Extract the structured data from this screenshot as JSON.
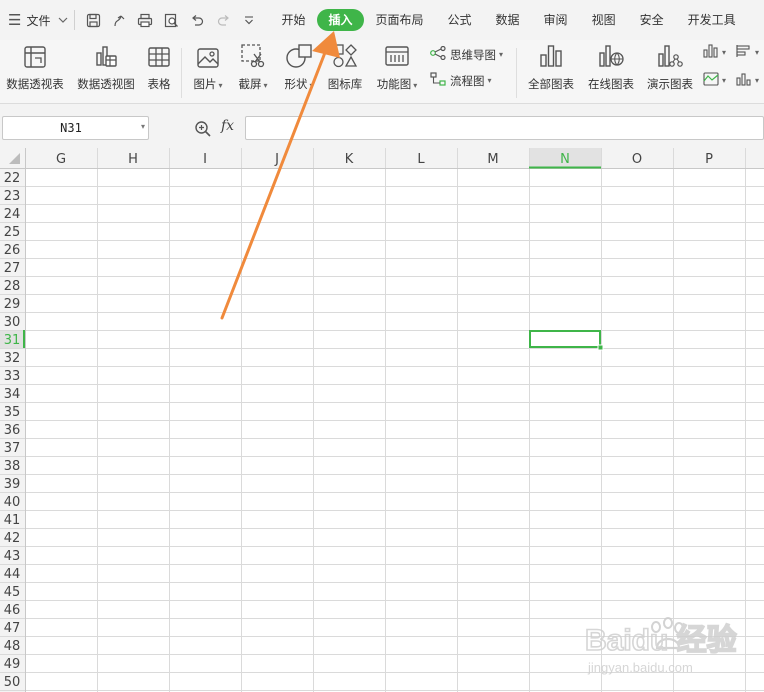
{
  "menubar": {
    "file_label": "文件",
    "tabs": [
      {
        "label": "开始",
        "active": false
      },
      {
        "label": "插入",
        "active": true
      },
      {
        "label": "页面布局",
        "active": false
      },
      {
        "label": "公式",
        "active": false
      },
      {
        "label": "数据",
        "active": false
      },
      {
        "label": "审阅",
        "active": false
      },
      {
        "label": "视图",
        "active": false
      },
      {
        "label": "安全",
        "active": false
      },
      {
        "label": "开发工具",
        "active": false
      }
    ]
  },
  "ribbon": {
    "pivot_table": "数据透视表",
    "pivot_chart": "数据透视图",
    "table": "表格",
    "picture": "图片",
    "screenshot": "截屏",
    "shapes": "形状",
    "icon_library": "图标库",
    "function_chart": "功能图",
    "mind_map": "思维导图",
    "flowchart": "流程图",
    "all_charts": "全部图表",
    "online_charts": "在线图表",
    "demo_charts": "演示图表"
  },
  "formula_bar": {
    "cell_ref": "N31",
    "fx": "fx",
    "formula": ""
  },
  "sheet": {
    "columns": [
      "G",
      "H",
      "I",
      "J",
      "K",
      "L",
      "M",
      "N",
      "O",
      "P"
    ],
    "rows": [
      22,
      23,
      24,
      25,
      26,
      27,
      28,
      29,
      30,
      31,
      32,
      33,
      34,
      35,
      36,
      37,
      38,
      39,
      40,
      41,
      42,
      43,
      44,
      45,
      46,
      47,
      48,
      49,
      50
    ],
    "selected_column": "N",
    "selected_row": 31
  },
  "watermark": {
    "brand": "Baidu 经验",
    "url": "jingyan.baidu.com"
  },
  "colors": {
    "accent_green": "#3fb549",
    "annotation_orange": "#f08a3c"
  }
}
